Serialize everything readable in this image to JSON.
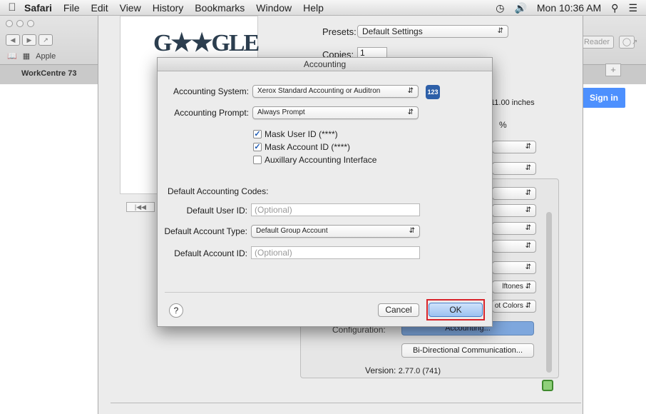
{
  "menubar": {
    "app_name": "Safari",
    "items": [
      "File",
      "Edit",
      "View",
      "History",
      "Bookmarks",
      "Window",
      "Help"
    ],
    "clock": "Mon 10:36 AM"
  },
  "browser": {
    "bookmark_label": "Apple",
    "tab_title": "WorkCentre 73",
    "reader_label": "Reader",
    "sign_in": "Sign in"
  },
  "print": {
    "presets_label": "Presets:",
    "presets_value": "Default Settings",
    "copies_label": "Copies:",
    "copies_value": "1",
    "paper_size_text": "11.00 inches",
    "percent_sign": "%",
    "side_options": [
      "",
      "",
      "",
      "",
      "",
      "",
      "",
      "",
      "lftones",
      "ot Colors"
    ],
    "configuration_label": "Configuration:",
    "configuration_value": "Accounting...",
    "bidi_button": "Bi-Directional Communication...",
    "version_label": "Version:",
    "version_value": "2.77.0 (741)"
  },
  "dialog": {
    "title": "Accounting",
    "system_label": "Accounting System:",
    "system_value": "Xerox Standard Accounting or Auditron",
    "prompt_label": "Accounting Prompt:",
    "prompt_value": "Always Prompt",
    "checkboxes": [
      {
        "label": "Mask User ID (****)",
        "checked": true
      },
      {
        "label": "Mask Account ID (****)",
        "checked": true
      },
      {
        "label": "Auxillary Accounting Interface",
        "checked": false
      }
    ],
    "codes_heading": "Default Accounting Codes:",
    "user_id_label": "Default User ID:",
    "user_id_placeholder": "(Optional)",
    "account_type_label": "Default Account Type:",
    "account_type_value": "Default Group Account",
    "account_id_label": "Default Account ID:",
    "account_id_placeholder": "(Optional)",
    "help_label": "?",
    "cancel_label": "Cancel",
    "ok_label": "OK"
  }
}
